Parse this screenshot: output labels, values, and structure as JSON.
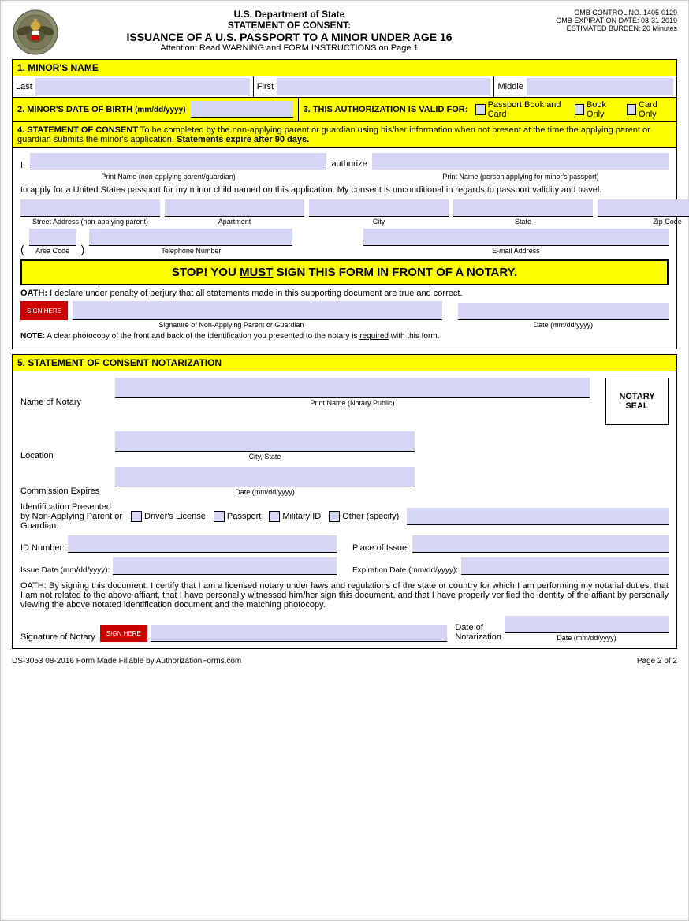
{
  "header": {
    "dept": "U.S. Department of State",
    "statement": "STATEMENT OF CONSENT:",
    "issuance": "ISSUANCE OF A U.S. PASSPORT TO A MINOR UNDER AGE 16",
    "attention": "Attention: Read WARNING and FORM INSTRUCTIONS on Page 1",
    "omb_control": "OMB CONTROL NO. 1405-0129",
    "omb_expiration": "OMB EXPIRATION DATE: 08-31-2019",
    "estimated_burden": "ESTIMATED BURDEN: 20 Minutes"
  },
  "section1": {
    "title": "1. MINOR'S NAME",
    "last_label": "Last",
    "first_label": "First",
    "middle_label": "Middle"
  },
  "section2": {
    "title": "2. MINOR'S DATE OF BIRTH",
    "date_format": "(mm/dd/yyyy)"
  },
  "section3": {
    "title": "3. THIS AUTHORIZATION IS VALID FOR:",
    "option1": "Passport Book and Card",
    "option2": "Book Only",
    "option3": "Card Only"
  },
  "section4": {
    "title": "4. STATEMENT OF CONSENT",
    "description": "To be completed by the non-applying parent or guardian using his/her information when not present at the time the applying parent or guardian submits the minor's application.",
    "expire_note": "Statements expire after 90 days.",
    "i_label": "I,",
    "authorize_label": "authorize",
    "print_name_1": "Print Name (non-applying parent/guardian)",
    "print_name_2": "Print Name (person applying for minor's passport)",
    "consent_text": "to apply for a United States passport for my minor child named on this application. My consent is unconditional in regards to passport validity and travel.",
    "street_label": "Street Address (non-applying parent)",
    "apt_label": "Apartment",
    "city_label": "City",
    "state_label": "State",
    "zip_label": "Zip Code",
    "area_code_label": "Area Code",
    "phone_label": "Telephone Number",
    "email_label": "E-mail Address",
    "stop_text": "STOP! YOU MUST SIGN THIS FORM IN FRONT OF A NOTARY.",
    "must_underline": "MUST",
    "oath_label": "OATH:",
    "oath_text": "I declare under penalty of perjury that all statements made in this supporting document are true and correct.",
    "sig_label": "Signature of Non-Applying Parent or Guardian",
    "date_label": "Date (mm/dd/yyyy)",
    "note_text": "NOTE: A clear photocopy of the front and back of the identification you presented to the notary is required with this form.",
    "required_underline": "required"
  },
  "section5": {
    "title": "5. STATEMENT OF CONSENT NOTARIZATION",
    "name_of_notary": "Name of Notary",
    "print_notary": "Print Name (Notary Public)",
    "location": "Location",
    "city_state": "City,  State",
    "commission_expires": "Commission Expires",
    "date_format": "Date (mm/dd/yyyy)",
    "notary_seal": "NOTARY\nSEAL",
    "id_presented": "Identification Presented\nby Non-Applying Parent or\nGuardian:",
    "drivers_license": "Driver's License",
    "passport": "Passport",
    "military_id": "Military ID",
    "other": "Other (specify)",
    "id_number": "ID Number:",
    "place_of_issue": "Place of Issue:",
    "issue_date": "Issue Date (mm/dd/yyyy):",
    "expiration_date": "Expiration Date (mm/dd/yyyy):",
    "oath_text": "OATH: By signing this document, I certify that I am a licensed notary under laws and regulations of the state or country for which I am performing my notarial duties, that I am not related to the above affiant, that I have personally witnessed him/her sign this document, and that I have properly verified the identity of the affiant by personally viewing the above notated identification document and the matching photocopy.",
    "sig_notary_label": "Signature of Notary",
    "date_of_notarization": "Date of\nNotarization",
    "date_format2": "Date (mm/dd/yyyy)"
  },
  "footer": {
    "form_info": "DS-3053   08-2016   Form Made Fillable by AuthorizationForms.com",
    "page": "Page 2 of 2"
  }
}
